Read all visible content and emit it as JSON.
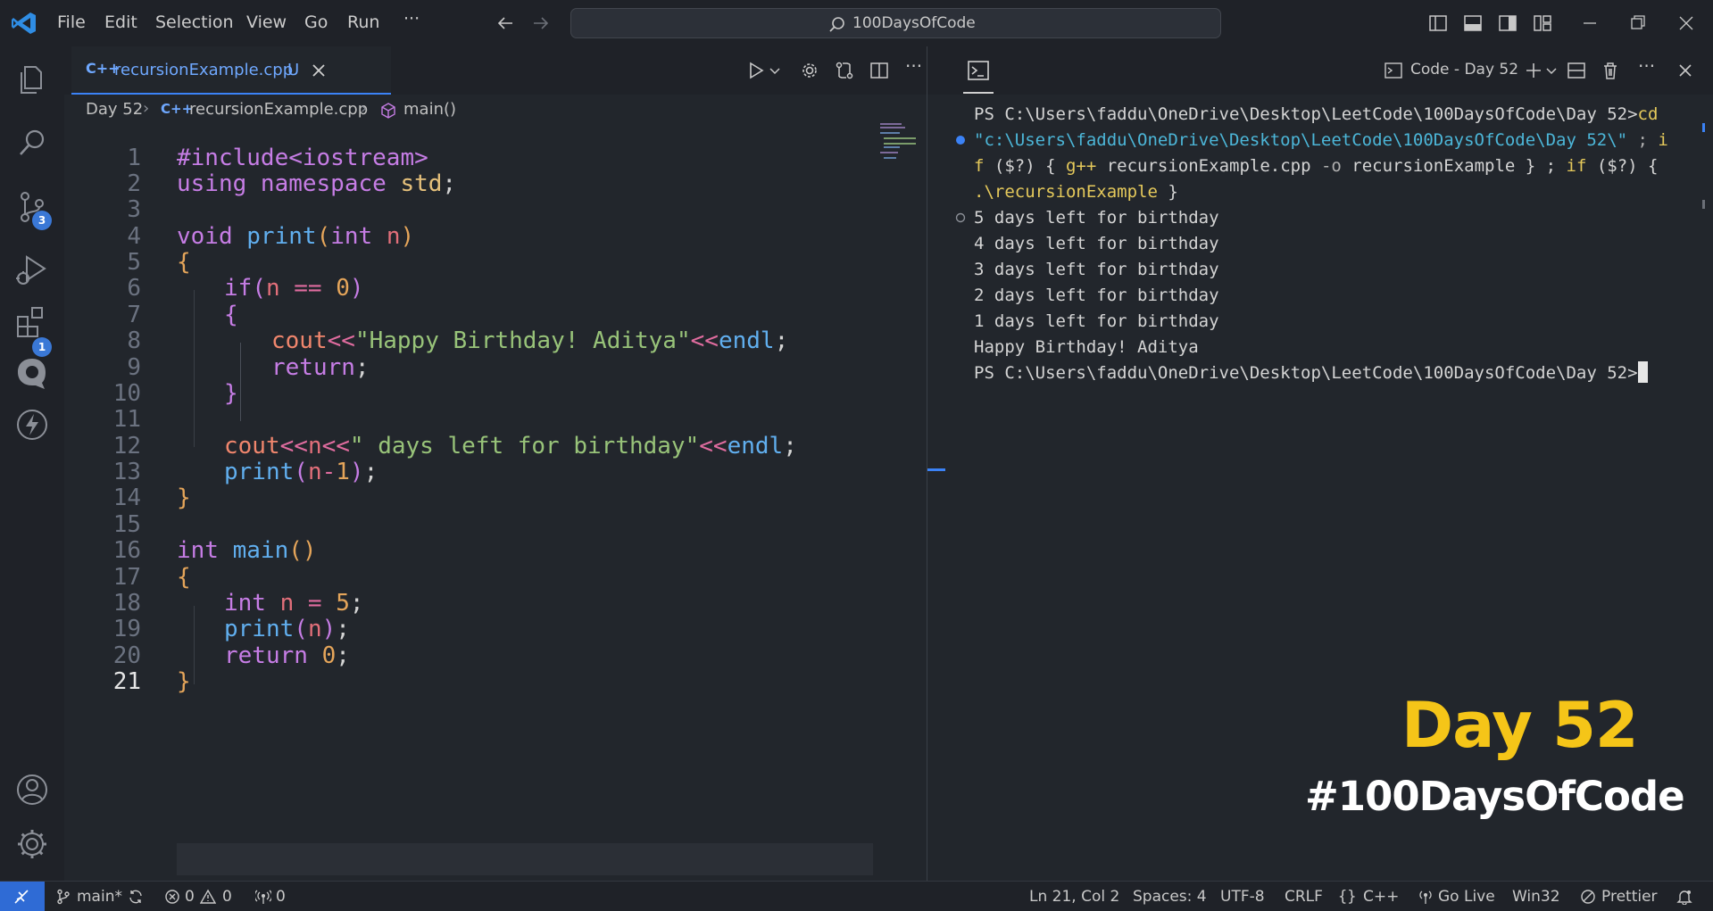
{
  "menu": [
    "File",
    "Edit",
    "Selection",
    "View",
    "Go",
    "Run",
    "···"
  ],
  "search": {
    "label": "100DaysOfCode"
  },
  "activity": {
    "scm_badge": "3",
    "extensions_badge": "1"
  },
  "tab": {
    "filename": "recursionExample.cpp",
    "status": "U"
  },
  "breadcrumb": {
    "folder": "Day 52",
    "file": "recursionExample.cpp",
    "symbol": "main()"
  },
  "code_lines": [
    "1",
    "2",
    "3",
    "4",
    "5",
    "6",
    "7",
    "8",
    "9",
    "10",
    "11",
    "12",
    "13",
    "14",
    "15",
    "16",
    "17",
    "18",
    "19",
    "20",
    "21"
  ],
  "code": {
    "l1": "#include<iostream>",
    "l2a": "using namespace ",
    "l2b": "std",
    "l2c": ";",
    "l4a": "void ",
    "l4b": "print",
    "l4c": "(",
    "l4d": "int ",
    "l4e": "n",
    "l4f": ")",
    "l5": "{",
    "l6a": "if",
    "l6b": "(",
    "l6c": "n",
    "l6d": " == ",
    "l6e": "0",
    "l6f": ")",
    "l7": "{",
    "l8a": "cout",
    "l8b": "<<",
    "l8c": "\"Happy Birthday! Aditya\"",
    "l8d": "<<",
    "l8e": "endl",
    "l8f": ";",
    "l9a": "return",
    "l9b": ";",
    "l10": "}",
    "l12a": "cout",
    "l12b": "<<",
    "l12c": "n",
    "l12d": "<<",
    "l12e": "\" days left for birthday\"",
    "l12f": "<<",
    "l12g": "endl",
    "l12h": ";",
    "l13a": "print",
    "l13b": "(",
    "l13c": "n",
    "l13d": "-",
    "l13e": "1",
    "l13f": ")",
    "l13g": ";",
    "l14": "}",
    "l16a": "int ",
    "l16b": "main",
    "l16c": "()",
    "l17": "{",
    "l18a": "int ",
    "l18b": "n",
    "l18c": " = ",
    "l18d": "5",
    "l18e": ";",
    "l19a": "print",
    "l19b": "(",
    "l19c": "n",
    "l19d": ")",
    "l19e": ";",
    "l20a": "return ",
    "l20b": "0",
    "l20c": ";",
    "l21": "}"
  },
  "panel": {
    "terminal_name": "Code - Day 52"
  },
  "terminal": {
    "l1a": "PS C:\\Users\\faddu\\OneDrive\\Desktop\\LeetCode\\100DaysOfCode\\Day 52>",
    "l1b": "cd",
    "l2a": "\"c:\\Users\\faddu\\OneDrive\\Desktop\\LeetCode\\100DaysOfCode\\Day 52\\\"",
    "l2b": " ; ",
    "l2c": "i",
    "l3a": "f",
    "l3b": " ($?) { ",
    "l3c": "g++",
    "l3d": " recursionExample.cpp ",
    "l3e": "-o",
    "l3f": " recursionExample } ; ",
    "l3g": "if",
    "l3h": " ($?) {",
    "l4a": ".\\recursionExample",
    "l4b": " }",
    "out": [
      "5 days left for birthday",
      "4 days left for birthday",
      "3 days left for birthday",
      "2 days left for birthday",
      "1 days left for birthday",
      "Happy Birthday! Aditya"
    ],
    "prompt": "PS C:\\Users\\faddu\\OneDrive\\Desktop\\LeetCode\\100DaysOfCode\\Day 52>"
  },
  "overlay": {
    "day": "Day 52",
    "hashtag": "#100DaysOfCode"
  },
  "status": {
    "branch": "main*",
    "errors": "0",
    "warnings": "0",
    "ports": "0",
    "position": "Ln 21, Col 2",
    "spaces": "Spaces: 4",
    "encoding": "UTF-8",
    "eol": "CRLF",
    "language": "C++",
    "golive": "Go Live",
    "platform": "Win32",
    "prettier": "Prettier"
  },
  "colors": {
    "accent": "#3b82f6",
    "overlay_day": "#f5c518",
    "badge": "#3a78d6"
  }
}
